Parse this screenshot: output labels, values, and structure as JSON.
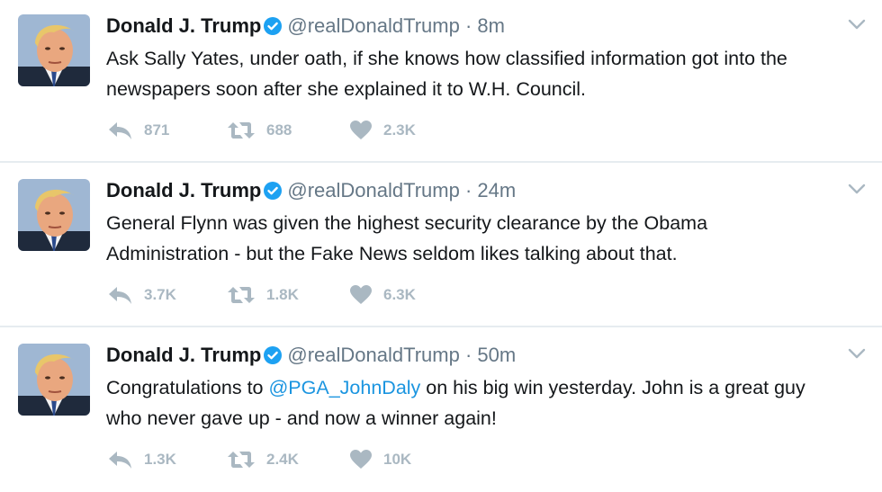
{
  "colors": {
    "text": "#14171a",
    "secondary": "#657786",
    "action_grey": "#aab8c2",
    "link_blue": "#1b95e0",
    "verified_blue": "#1da1f2",
    "divider": "#e6ecf0"
  },
  "icons": {
    "verified": "verified-badge-icon",
    "caret": "chevron-down-icon",
    "reply": "reply-icon",
    "retweet": "retweet-icon",
    "like": "heart-icon"
  },
  "tweets": [
    {
      "name": "Donald J. Trump",
      "handle": "@realDonaldTrump",
      "separator": "·",
      "time": "8m",
      "text_before": "Ask Sally Yates, under oath, if she knows how classified information got into the\nnewspapers soon after she explained it to W.H. Council.",
      "mention": "",
      "text_after": "",
      "replies": "871",
      "retweets": "688",
      "likes": "2.3K"
    },
    {
      "name": "Donald J. Trump",
      "handle": "@realDonaldTrump",
      "separator": "·",
      "time": "24m",
      "text_before": "General Flynn was given the highest security clearance by the Obama\nAdministration - but the Fake News seldom likes talking about that.",
      "mention": "",
      "text_after": "",
      "replies": "3.7K",
      "retweets": "1.8K",
      "likes": "6.3K"
    },
    {
      "name": "Donald J. Trump",
      "handle": "@realDonaldTrump",
      "separator": "·",
      "time": "50m",
      "text_before": "Congratulations to ",
      "mention": "@PGA_JohnDaly",
      "text_after": " on his big win yesterday. John is a great guy\nwho never gave up - and now a winner again!",
      "replies": "1.3K",
      "retweets": "2.4K",
      "likes": "10K"
    }
  ]
}
